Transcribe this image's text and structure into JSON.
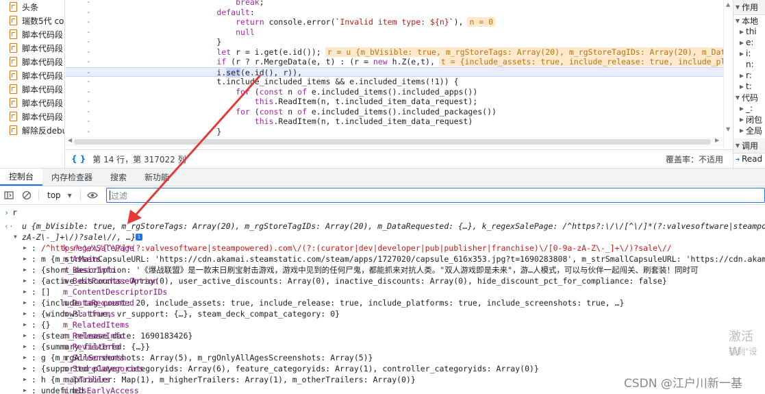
{
  "files": [
    "头条",
    "瑞数5代 co",
    "脚本代码段",
    "脚本代码段",
    "脚本代码段",
    "脚本代码段",
    "脚本代码段",
    "脚本代码段",
    "脚本代码段",
    "解除反debu"
  ],
  "code_lines": [
    {
      "indent": "            ",
      "tokens": [
        [
          "kw",
          "break"
        ],
        [
          "p",
          ";"
        ]
      ]
    },
    {
      "indent": "        ",
      "tokens": [
        [
          "kw",
          "default"
        ],
        [
          "p",
          ":"
        ]
      ]
    },
    {
      "indent": "            ",
      "tokens": [
        [
          "kw",
          "return"
        ],
        [
          "p",
          " console.error(`"
        ],
        [
          "str",
          "Invalid item type: ${n}"
        ],
        [
          "p",
          "`),"
        ],
        [
          "inl",
          "n = 0"
        ]
      ]
    },
    {
      "indent": "            ",
      "tokens": [
        [
          "kw",
          "null"
        ]
      ]
    },
    {
      "indent": "        ",
      "tokens": [
        [
          "p",
          "}"
        ]
      ]
    },
    {
      "indent": "        ",
      "tokens": [
        [
          "kw",
          "let"
        ],
        [
          "p",
          " r = i.get(e.id());"
        ],
        [
          "inl",
          "r = u {m_bVisible: true, m_rgStoreTags: Array(20), m_rgStoreTagIDs: Array(20), m_DataRequested:"
        ]
      ]
    },
    {
      "indent": "        ",
      "tokens": [
        [
          "kw",
          "if"
        ],
        [
          "p",
          " (r ? r.MergeData(e, t) : (r = "
        ],
        [
          "kw",
          "new"
        ],
        [
          "p",
          " h.Z(e,t),"
        ],
        [
          "inl",
          "t = {include_assets: true, include_release: true, include_platforms: tru"
        ]
      ]
    },
    {
      "indent": "        ",
      "tokens": [
        [
          "p",
          "i."
        ],
        [
          "sel",
          "set"
        ],
        [
          "p",
          "(e.id(), r)),"
        ]
      ]
    },
    {
      "indent": "        ",
      "tokens": [
        [
          "p",
          "t.include_included_items && e.included_items(!1)) {"
        ]
      ]
    },
    {
      "indent": "            ",
      "tokens": [
        [
          "kw",
          "for"
        ],
        [
          "p",
          " ("
        ],
        [
          "kw",
          "const"
        ],
        [
          "p",
          " n "
        ],
        [
          "kw",
          "of"
        ],
        [
          "p",
          " e.included_items().included_apps())"
        ]
      ]
    },
    {
      "indent": "                ",
      "tokens": [
        [
          "kw",
          "this"
        ],
        [
          "p",
          ".ReadItem(n, t.included_item_data_request);"
        ]
      ]
    },
    {
      "indent": "            ",
      "tokens": [
        [
          "kw",
          "for"
        ],
        [
          "p",
          " ("
        ],
        [
          "kw",
          "const"
        ],
        [
          "p",
          " n "
        ],
        [
          "kw",
          "of"
        ],
        [
          "p",
          " e.included_items().included_packages())"
        ]
      ]
    },
    {
      "indent": "                ",
      "tokens": [
        [
          "kw",
          "this"
        ],
        [
          "p",
          ".ReadItem(n, t.included_item_data_request)"
        ]
      ]
    },
    {
      "indent": "        ",
      "tokens": [
        [
          "p",
          "}"
        ]
      ]
    }
  ],
  "status": {
    "position": "第 14 行，第 317022 列",
    "coverage": "覆盖率：不适用"
  },
  "right_pane": {
    "header": "作用",
    "rows": [
      {
        "tri": "▼",
        "text": "本地"
      },
      {
        "tri": "▶",
        "text": "thi"
      },
      {
        "tri": "▶",
        "text": "e:"
      },
      {
        "tri": "▶",
        "text": "i:"
      },
      {
        "tri": "",
        "text": "n:"
      },
      {
        "tri": "▶",
        "text": "r:"
      },
      {
        "tri": "▶",
        "text": "t:"
      },
      {
        "tri": "▼",
        "text": "代码"
      },
      {
        "tri": "▶",
        "text": "_:"
      },
      {
        "tri": "▶",
        "text": "闭包"
      },
      {
        "tri": "▶",
        "text": "全局"
      }
    ],
    "call_stack": "调用",
    "read_label": "Read"
  },
  "tabs": [
    "控制台",
    "内存检查器",
    "搜索",
    "新功能"
  ],
  "toolbar": {
    "context": "top",
    "filter_placeholder": "过滤"
  },
  "console": {
    "input": "r",
    "summary_prefix": "u {m_bVisible: true, m_rgStoreTags: Array(20), m_rgStoreTagIDs: Array(20), m_DataRequested: {…}, k_regexSalePage: /^https?:\\/\\/[^\\/]*(?:valvesoftware|steampowered)..",
    "summary_line2": "zA-Z\\-_]+\\/)?sale\\//, …}",
    "props": [
      {
        "name": "k_regexSalePage",
        "value": "/^https?:\\/\\/[^\\/]*(?:valvesoftware|steampowered).com\\/(?:(curator|dev|developer|pub|publisher|franchise)\\/[0-9a-zA-Z\\-_]+\\/)?sale\\//",
        "kind": "str"
      },
      {
        "name": "m_Assets",
        "value": "m {m_strMainCapsuleURL: 'https://cdn.akamai.steamstatic.com/steam/apps/1727020/capsule_616x353.jpg?t=1690283808', m_strSmallCapsuleURL: 'https://cdn.akam",
        "kind": "val"
      },
      {
        "name": "m_BasicInfo",
        "value": "{short_description: '《爆战联盟》是一款末日刷宝射击游戏，游戏中见到的任何尸鬼，都能抓来对抗人类。\"双人游戏即是未来\"，游…人模式，可以与伙伴一起闯关、刷套装！同时可",
        "kind": "val"
      },
      {
        "name": "m_BestPurchaseOption",
        "value": "{active_discounts: Array(0), user_active_discounts: Array(0), inactive_discounts: Array(0), hide_discount_pct_for_compliance: false}",
        "kind": "val"
      },
      {
        "name": "m_ContentDescriptorIDs",
        "value": "[]",
        "kind": "val"
      },
      {
        "name": "m_DataRequested",
        "value": "{include_tag_count: 20, include_assets: true, include_release: true, include_platforms: true, include_screenshots: true, …}",
        "kind": "val"
      },
      {
        "name": "m_Platforms",
        "value": "{windows: true, vr_support: {…}, steam_deck_compat_category: 0}",
        "kind": "val"
      },
      {
        "name": "m_RelatedItems",
        "value": "{}",
        "kind": "val"
      },
      {
        "name": "m_ReleaseInfo",
        "value": "{steam_release_date: 1690183426}",
        "kind": "val"
      },
      {
        "name": "m_ReviewInfo",
        "value": "{summary_filtered: {…}}",
        "kind": "val"
      },
      {
        "name": "m_Screenshots",
        "value": "g {m_rgAllScreenshots: Array(5), m_rgOnlyAllAgesScreenshots: Array(5)}",
        "kind": "val"
      },
      {
        "name": "m_StoreCategories",
        "value": "{supported_player_categoryids: Array(6), feature_categoryids: Array(1), controller_categoryids: Array(0)}",
        "kind": "val"
      },
      {
        "name": "m_Trailers",
        "value": "h {m_mapTrailer: Map(1), m_higherTrailers: Array(1), m_otherTrailers: Array(0)}",
        "kind": "val"
      },
      {
        "name": "m_bIsEarlyAccess",
        "value": "undefined",
        "kind": "val"
      }
    ]
  },
  "watermark": {
    "line1": "激活 W",
    "line2": "转到\"设"
  },
  "csdn": "CSDN @江户川新一基",
  "colors": {
    "accent": "#1a73e8",
    "arrow": "#e53935",
    "inline_value_bg": "#ffe9cc"
  }
}
